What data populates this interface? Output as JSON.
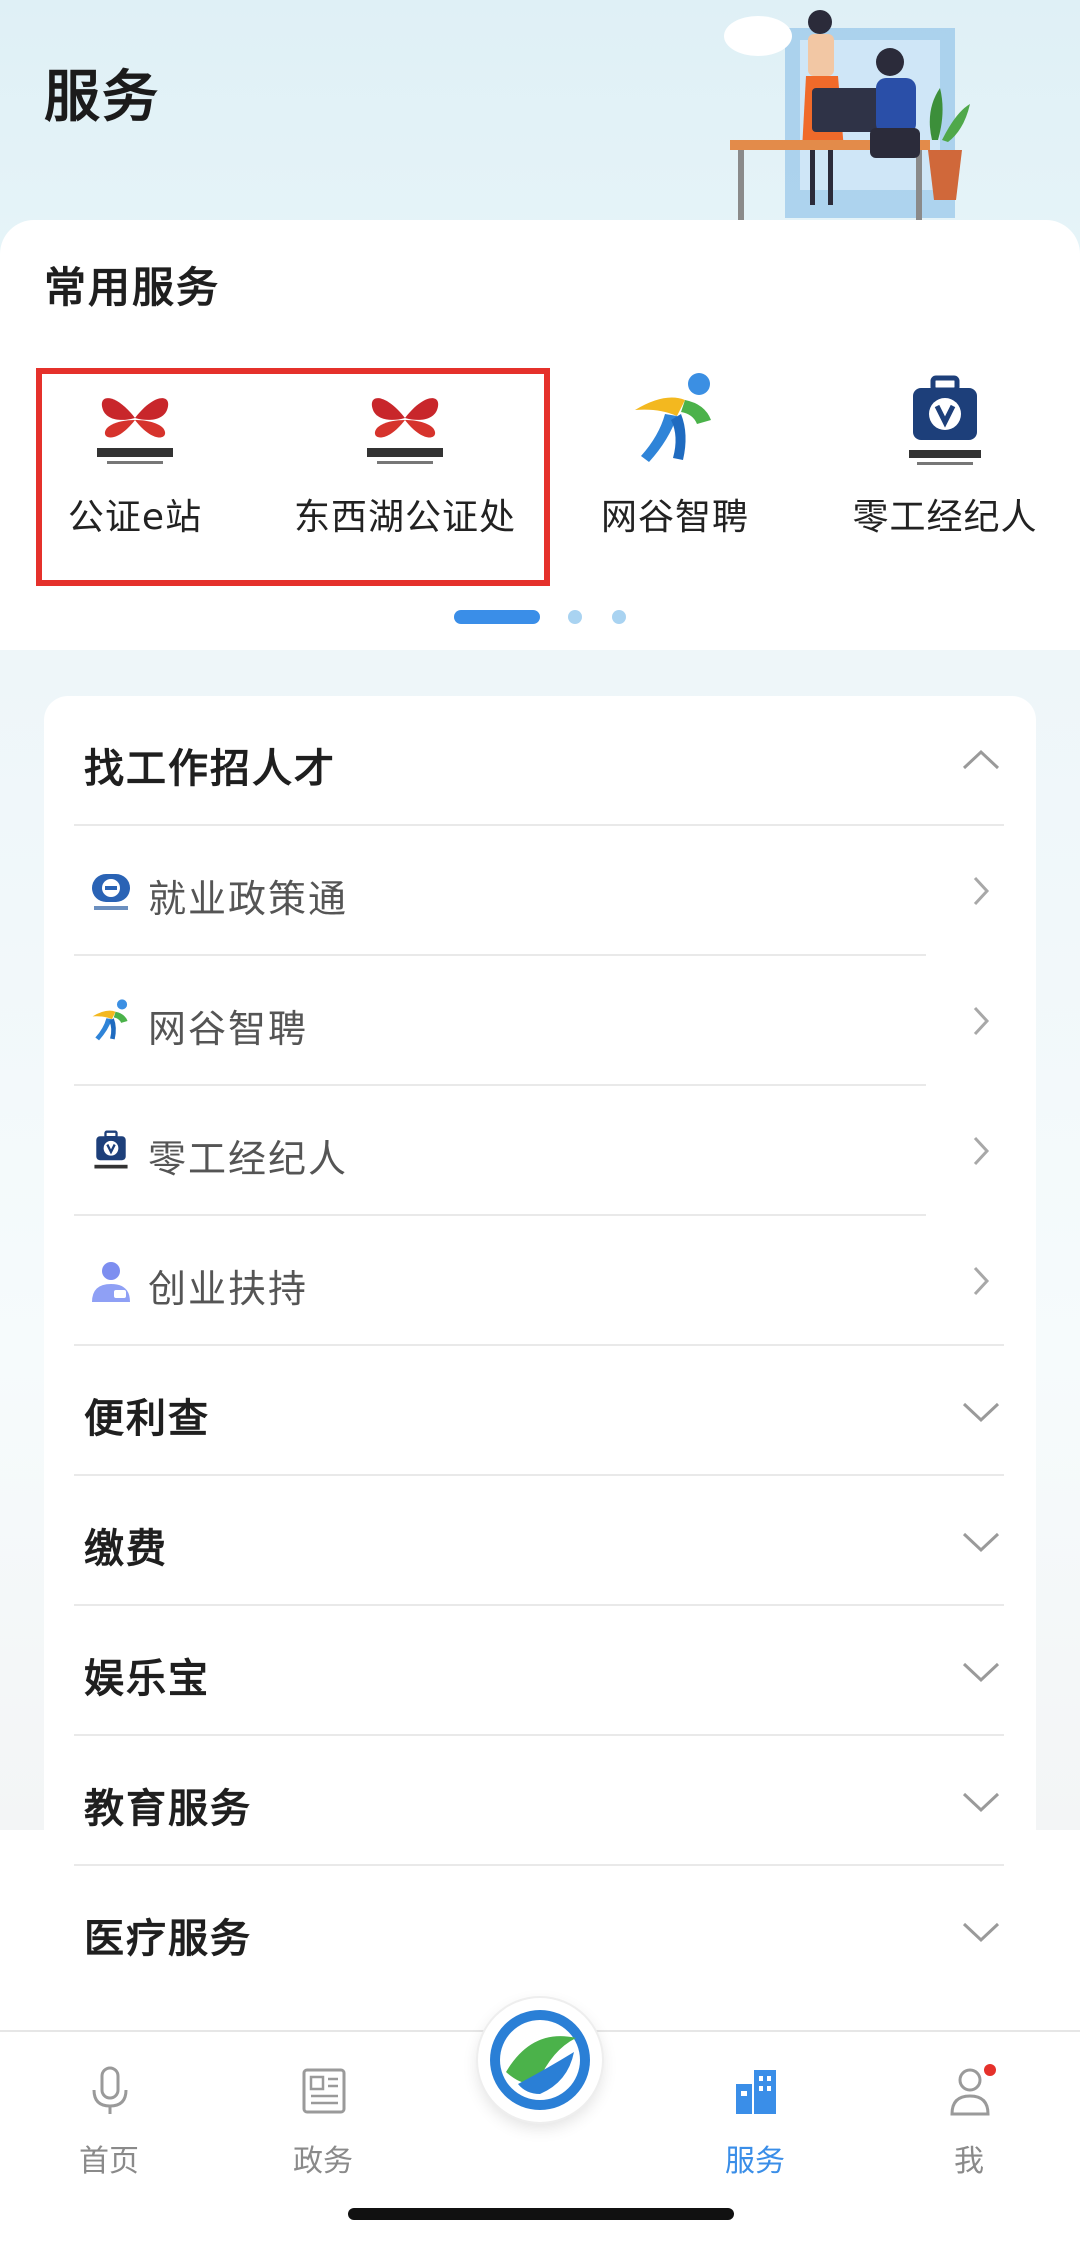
{
  "page": {
    "title": "服务"
  },
  "common_services": {
    "title": "常用服务",
    "items": [
      {
        "label": "公证e站",
        "icon": "notary-logo-icon",
        "logo_text": "东西湖公证"
      },
      {
        "label": "东西湖公证处",
        "icon": "notary-logo-icon",
        "logo_text": "东西湖公证"
      },
      {
        "label": "网谷智聘",
        "icon": "running-figure-icon"
      },
      {
        "label": "零工经纪人",
        "icon": "briefcase-logo-icon",
        "logo_text": "零工经纪人"
      }
    ],
    "pager": {
      "pages": 3,
      "current": 1
    }
  },
  "categories": [
    {
      "label": "找工作招人才",
      "expanded": true,
      "items": [
        {
          "label": "就业政策通",
          "icon": "policy-logo-icon"
        },
        {
          "label": "网谷智聘",
          "icon": "running-figure-icon"
        },
        {
          "label": "零工经纪人",
          "icon": "briefcase-logo-icon"
        },
        {
          "label": "创业扶持",
          "icon": "person-icon"
        }
      ]
    },
    {
      "label": "便利查",
      "expanded": false
    },
    {
      "label": "缴费",
      "expanded": false
    },
    {
      "label": "娱乐宝",
      "expanded": false
    },
    {
      "label": "教育服务",
      "expanded": false
    },
    {
      "label": "医疗服务",
      "expanded": false
    }
  ],
  "bottom_nav": {
    "items": [
      {
        "label": "首页",
        "icon": "microphone-icon"
      },
      {
        "label": "政务",
        "icon": "newspaper-icon"
      },
      {
        "label": "服务",
        "icon": "buildings-icon",
        "active": true
      },
      {
        "label": "我",
        "icon": "user-icon",
        "badge": true
      }
    ],
    "center_icon": "app-logo-icon"
  },
  "colors": {
    "accent": "#3a8ee8",
    "highlight_box": "#e5312b",
    "notary_red": "#c8262b",
    "badge_red": "#e5312b"
  }
}
